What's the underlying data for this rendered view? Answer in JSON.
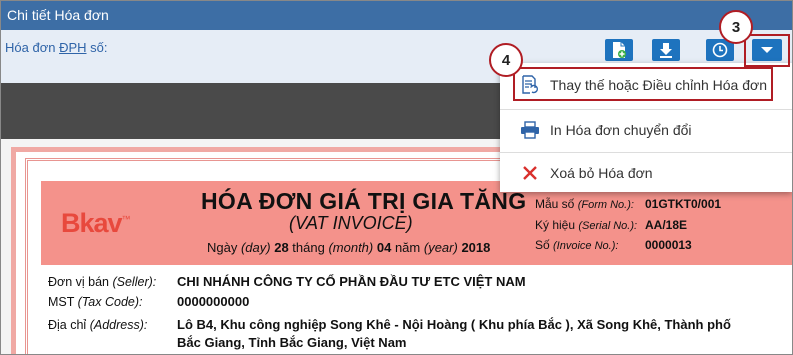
{
  "window": {
    "title": "Chi tiết Hóa đơn"
  },
  "toolbar": {
    "label_prefix": "Hóa đơn ",
    "label_underlined": "ĐPH",
    "label_suffix": " số:",
    "icons": [
      "file-add-icon",
      "download-icon",
      "clock-icon",
      "caret-down-icon"
    ],
    "accent": "#1e73be"
  },
  "menu": {
    "items": [
      {
        "label": "Thay thế hoặc Điều chỉnh Hóa đơn",
        "icon": "document-refresh-icon"
      },
      {
        "label": "In Hóa đơn chuyển đổi",
        "icon": "printer-icon"
      },
      {
        "label": "Xoá bỏ Hóa đơn",
        "icon": "close-x-icon"
      }
    ]
  },
  "callouts": {
    "dropdown": "3",
    "replace_item": "4"
  },
  "invoice": {
    "logo": "Bkav",
    "title": "HÓA ĐƠN GIÁ TRỊ GIA TĂNG",
    "subtitle": "(VAT INVOICE)",
    "date": {
      "day_word": "Ngày ",
      "day_en": "(day)",
      "day": "28",
      "month_word": " tháng ",
      "month_en": "(month)",
      "month": "04",
      "year_word": " năm ",
      "year_en": "(year)",
      "year": "2018"
    },
    "form_label": "Mẫu số ",
    "form_label_en": "(Form No.):",
    "form_no": "01GTKT0/001",
    "serial_label": "Ký hiệu ",
    "serial_label_en": "(Serial No.):",
    "serial_no": "AA/18E",
    "invoice_label": "Số ",
    "invoice_label_en": "(Invoice No.):",
    "invoice_no": "0000013",
    "seller_label": "Đơn vị bán ",
    "seller_label_en": "(Seller):",
    "seller": "CHI NHÁNH CÔNG TY CỔ PHẦN ĐẦU TƯ ETC VIỆT NAM",
    "tax_label": "MST ",
    "tax_label_en": "(Tax Code):",
    "tax_code": "0000000000",
    "address_label": "Địa chỉ ",
    "address_label_en": "(Address):",
    "address_line1": "Lô B4, Khu công nghiệp Song Khê - Nội Hoàng ( Khu phía Bắc ), Xã Song Khê, Thành phố",
    "address_line2": "Bắc Giang, Tỉnh Bắc Giang, Việt Nam",
    "header_color": "#f4928b"
  }
}
